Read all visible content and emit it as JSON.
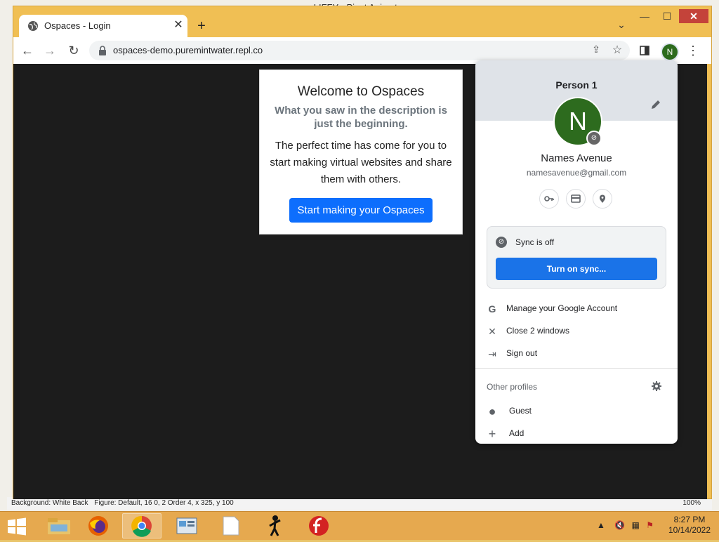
{
  "background_app": {
    "title": "LIFFY - Pivot Animator",
    "status_left": "Background: White Back",
    "status_mid": "Figure: Default, 16 0, 2 Order 4, x 325, y 100",
    "status_right": "100%"
  },
  "browser": {
    "tab_title": "Ospaces - Login",
    "url": "ospaces-demo.puremintwater.repl.co",
    "profile_initial": "N",
    "window_buttons": {
      "min": "—",
      "max": "☐",
      "close": "✕"
    }
  },
  "card": {
    "title": "Welcome to Ospaces",
    "subtitle": "What you saw in the description is just the beginning.",
    "body": "The perfect time has come for you to start making virtual websites and share them with others.",
    "button": "Start making your Ospaces"
  },
  "profile_menu": {
    "person_label": "Person 1",
    "avatar_initial": "N",
    "full_name": "Names Avenue",
    "email": "namesavenue@gmail.com",
    "sync_status": "Sync is off",
    "sync_button": "Turn on sync...",
    "items": [
      {
        "label": "Manage your Google Account",
        "icon": "google-icon"
      },
      {
        "label": "Close 2 windows",
        "icon": "close-icon"
      },
      {
        "label": "Sign out",
        "icon": "sign-out-icon"
      }
    ],
    "other_profiles_title": "Other profiles",
    "guest_label": "Guest",
    "add_label": "Add"
  },
  "taskbar": {
    "time": "8:27 PM",
    "date": "10/14/2022",
    "apps": [
      "file-explorer",
      "firefox",
      "chrome",
      "control-panel",
      "notepad",
      "pivot-animator",
      "flash"
    ]
  },
  "colors": {
    "chrome_frame": "#f0bf54",
    "taskbar": "#e6a94f",
    "primary_button": "#0d6efd",
    "sync_button": "#1a73e8",
    "avatar": "#2d6b1e"
  }
}
